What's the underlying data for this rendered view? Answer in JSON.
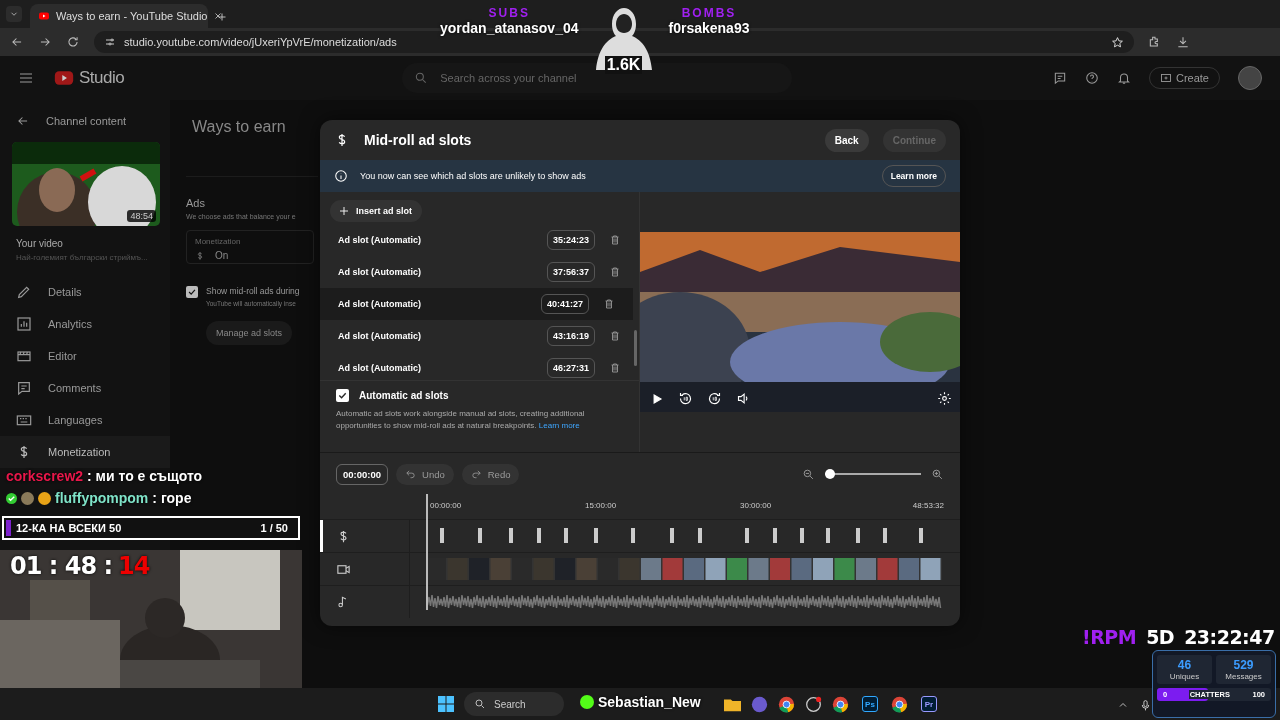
{
  "browser": {
    "tab_title": "Ways to earn - YouTube Studio",
    "url": "studio.youtube.com/video/jUxeriYpVrE/monetization/ads"
  },
  "studio": {
    "logo": "Studio",
    "search": {
      "placeholder": "Search across your channel"
    },
    "create": "Create"
  },
  "sidebar": {
    "back": "Channel content",
    "duration": "48:54",
    "video_label": "Your video",
    "video_title": "Най-големият български стриймъ...",
    "items": [
      {
        "label": "Details",
        "kind": "pencil",
        "selected": false
      },
      {
        "label": "Analytics",
        "kind": "chart",
        "selected": false
      },
      {
        "label": "Editor",
        "kind": "clapper",
        "selected": false
      },
      {
        "label": "Comments",
        "kind": "comment",
        "selected": false
      },
      {
        "label": "Languages",
        "kind": "keyboard",
        "selected": false
      },
      {
        "label": "Monetization",
        "kind": "dollar",
        "selected": true
      }
    ]
  },
  "page": {
    "title": "Ways to earn",
    "ads_heading": "Ads",
    "ads_text": "We choose ads that balance your e",
    "field_label": "Monetization",
    "field_value": "On",
    "midroll": {
      "label": "Show mid-roll ads during",
      "hint": "YouTube will automatically inse",
      "checked": true
    },
    "manage_button": "Manage ad slots"
  },
  "dialog": {
    "title": "Mid-roll ad slots",
    "back": "Back",
    "continue": {
      "label": "Continue",
      "disabled": true
    },
    "banner": {
      "text": "You now can see which ad slots are unlikely to show ads",
      "action": "Learn more"
    },
    "insert": "Insert ad slot",
    "slots": [
      {
        "label": "Ad slot (Automatic)",
        "time": "35:24:23",
        "hovered": false
      },
      {
        "label": "Ad slot (Automatic)",
        "time": "37:56:37",
        "hovered": false
      },
      {
        "label": "Ad slot (Automatic)",
        "time": "40:41:27",
        "hovered": true
      },
      {
        "label": "Ad slot (Automatic)",
        "time": "43:16:19",
        "hovered": false
      },
      {
        "label": "Ad slot (Automatic)",
        "time": "46:27:31",
        "hovered": false
      }
    ],
    "automatic": {
      "label": "Automatic ad slots",
      "checked": true,
      "text": "Automatic ad slots work alongside manual ad slots, creating additional opportunities to show mid-roll ads at natural breakpoints.",
      "link": "Learn more"
    },
    "timeline": {
      "time": "00:00:00",
      "undo": {
        "label": "Undo",
        "disabled": true
      },
      "redo": {
        "label": "Redo",
        "disabled": true
      },
      "zoom": {
        "level": 0
      },
      "ruler": [
        "00:00:00",
        "15:00:00",
        "30:00:00",
        "48:53:32"
      ]
    }
  },
  "stream": {
    "subs_label": "SUBS",
    "subs_name": "yordan_atanasov_04",
    "bombs_label": "BOMBS",
    "bombs_name": "f0rsakena93",
    "count": "1.6K",
    "chat": [
      {
        "user": "corkscrew2",
        "color": "#e8174a",
        "text": ": ми то е същото",
        "badges": false
      },
      {
        "user": "fluffypompom",
        "color": "#7fe3c8",
        "text": ": горе",
        "badges": true
      }
    ],
    "goal": {
      "label": "12-КА НА ВСЕКИ 50",
      "count": "1 / 50",
      "level": 0.02
    },
    "timer": {
      "head": "01 : 48 :",
      "tail": "14"
    },
    "rpm": {
      "label": "!RPM",
      "days": "5D",
      "time": "23:22:47"
    },
    "stats": [
      {
        "value": "46",
        "label": "Uniques"
      },
      {
        "value": "529",
        "label": "Messages"
      }
    ],
    "chatters": {
      "min": "0",
      "label": "CHATTERS",
      "max": "100",
      "level": 0.45
    }
  },
  "taskbar": {
    "search": "Search",
    "overlay_name": "Sebastian_New",
    "apps": [
      {
        "kind": "folder"
      },
      {
        "kind": "chat"
      },
      {
        "kind": "chrome"
      },
      {
        "kind": "steam"
      },
      {
        "kind": "chrome"
      },
      {
        "kind": "text",
        "label": "Ps",
        "color": "#31a8ff"
      },
      {
        "kind": "chrome"
      },
      {
        "kind": "text",
        "label": "Pr",
        "color": "#9999ff"
      }
    ]
  }
}
